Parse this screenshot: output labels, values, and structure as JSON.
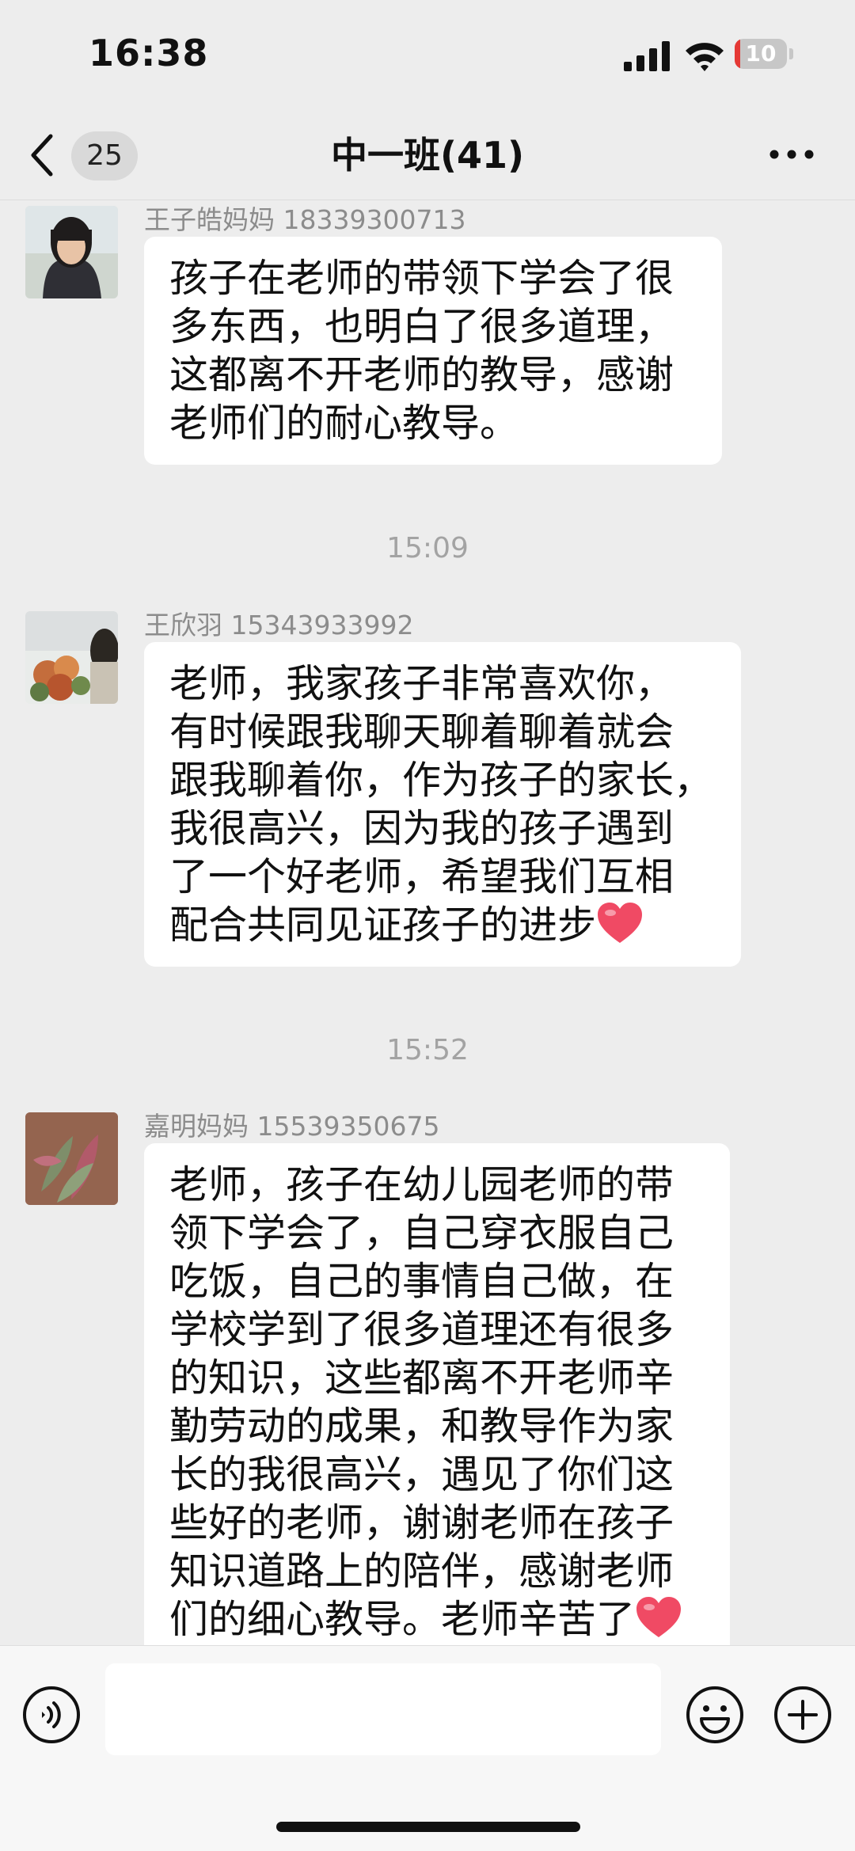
{
  "status_bar": {
    "time": "16:38",
    "battery_level": "10",
    "battery_fraction": 0.1,
    "battery_color": "#e53935"
  },
  "nav": {
    "back_icon": "chevron-left-icon",
    "unread_count": "25",
    "title": "中一班(41)",
    "more_icon": "more-horizontal-icon"
  },
  "messages": [
    {
      "sender": "王子皓妈妈 18339300713",
      "text": "孩子在老师的带领下学会了很\n多东西，也明白了很多道理，\n这都离不开老师的教导，感谢\n老师们的耐心教导。",
      "avatar": "woman-portrait-avatar",
      "ends_with_heart": false
    },
    {
      "sender": "王欣羽 15343933992",
      "text": "老师，我家孩子非常喜欢你，\n有时候跟我聊天聊着聊着就会\n跟我聊着你，作为孩子的家长，\n我很高兴，因为我的孩子遇到\n了一个好老师，希望我们互相\n配合共同见证孩子的进步",
      "avatar": "flowers-avatar",
      "ends_with_heart": true
    },
    {
      "sender": "嘉明妈妈 15539350675",
      "text": "老师，孩子在幼儿园老师的带\n领下学会了，自己穿衣服自己\n吃饭，自己的事情自己做，在\n学校学到了很多道理还有很多\n的知识，这些都离不开老师辛\n勤劳动的成果，和教导作为家\n长的我很高兴，遇见了你们这\n些好的老师，谢谢老师在孩子\n知识道路上的陪伴，感谢老师\n们的细心教导。老师辛苦了",
      "avatar": "plant-avatar",
      "ends_with_heart": true
    }
  ],
  "timestamps": [
    "15:09",
    "15:52"
  ],
  "input_bar": {
    "voice_icon": "voice-icon",
    "input_value": "",
    "emoji_icon": "emoji-icon",
    "plus_icon": "plus-icon"
  },
  "colors": {
    "background": "#ededed",
    "bubble": "#ffffff",
    "sender_text": "#8c8c8c",
    "heart": "#f04a64"
  }
}
